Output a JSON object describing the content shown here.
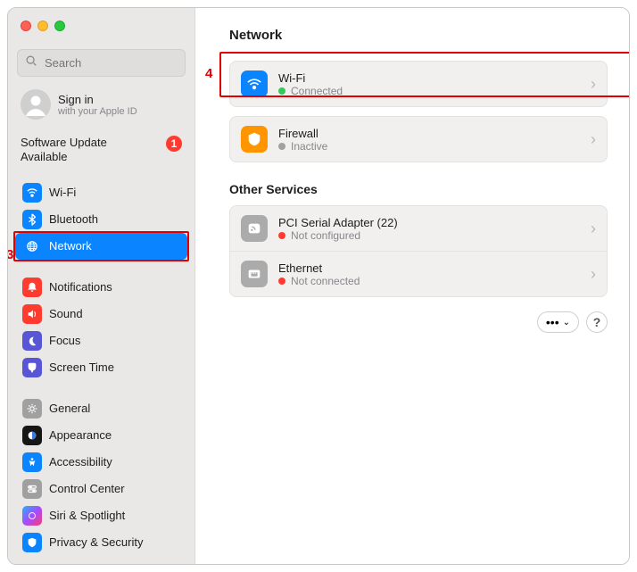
{
  "window": {
    "search_placeholder": "Search",
    "signin": {
      "title": "Sign in",
      "subtitle": "with your Apple ID"
    },
    "update": {
      "label": "Software Update Available",
      "badge": "1"
    }
  },
  "sidebar": {
    "group1": {
      "wifi": "Wi-Fi",
      "bluetooth": "Bluetooth",
      "network": "Network"
    },
    "group2": {
      "notifications": "Notifications",
      "sound": "Sound",
      "focus": "Focus",
      "screentime": "Screen Time"
    },
    "group3": {
      "general": "General",
      "appearance": "Appearance",
      "accessibility": "Accessibility",
      "controlcenter": "Control Center",
      "siri": "Siri & Spotlight",
      "privacy": "Privacy & Security"
    }
  },
  "annotations": {
    "sidebar": "3",
    "main": "4"
  },
  "main": {
    "title": "Network",
    "other_label": "Other Services",
    "services": {
      "wifi": {
        "name": "Wi-Fi",
        "status": "Connected",
        "color": "#34c759"
      },
      "firewall": {
        "name": "Firewall",
        "status": "Inactive",
        "color": "#a1a1a1"
      },
      "pci": {
        "name": "PCI Serial Adapter (22)",
        "status": "Not configured",
        "color": "#ff3b30"
      },
      "ethernet": {
        "name": "Ethernet",
        "status": "Not connected",
        "color": "#ff3b30"
      }
    },
    "more": "•••",
    "help": "?"
  }
}
